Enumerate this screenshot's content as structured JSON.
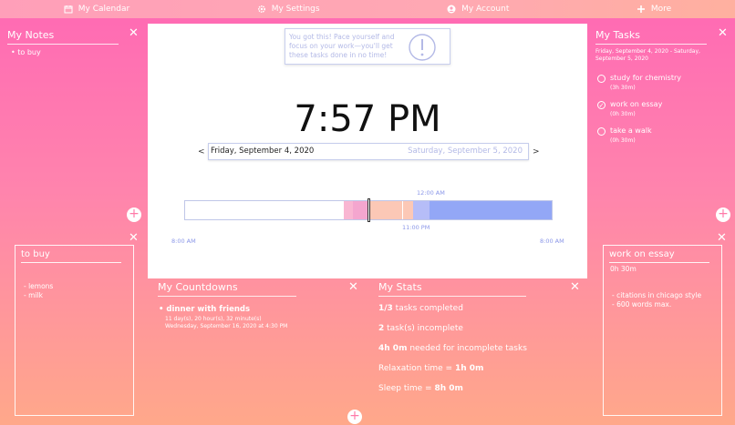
{
  "nav": {
    "calendar": "My Calendar",
    "settings": "My Settings",
    "account": "My Account",
    "more": "More"
  },
  "notes": {
    "title": "My Notes",
    "items": [
      "to buy"
    ]
  },
  "tasks": {
    "title": "My Tasks",
    "range": "Friday, September 4, 2020 - Saturday, September 5, 2020",
    "items": [
      {
        "name": "study for chemistry",
        "duration": "(3h 30m)",
        "done": false
      },
      {
        "name": "work on essay",
        "duration": "(0h 30m)",
        "done": true
      },
      {
        "name": "take a walk",
        "duration": "(0h 30m)",
        "done": false
      }
    ]
  },
  "motivation": "You got this! Pace yourself and focus on your work—you'll get these tasks done in no time!",
  "clock": "7:57 PM",
  "date_nav": {
    "prev": "<",
    "next": ">",
    "current": "Friday, September 4, 2020",
    "next_day": "Saturday, September 5, 2020"
  },
  "timeline": {
    "label_midnight": "12:00 AM",
    "label_11pm": "11:00 PM",
    "label_start": "8:00 AM",
    "label_end": "8:00 AM"
  },
  "card_left": {
    "title": "to buy",
    "items": [
      "- lemons",
      "- milk"
    ]
  },
  "card_right": {
    "title": "work on essay",
    "duration": "0h  30m",
    "items": [
      "- citations in chicago style",
      "- 600 words max."
    ]
  },
  "countdowns": {
    "title": "My Countdowns",
    "name": "dinner with friends",
    "remaining": "11 day(s), 20 hour(s), 32 minute(s)",
    "date": "Wednesday, September 16, 2020 at 4:30 PM"
  },
  "stats": {
    "title": "My Stats",
    "completed_num": "1/3",
    "completed_text": " tasks completed",
    "incomplete_num": "2",
    "incomplete_text": " task(s) incomplete",
    "needed_num": "4h 0m",
    "needed_text": " needed for incomplete tasks",
    "relax_text": "Relaxation time = ",
    "relax_num": "1h 0m",
    "sleep_text": "Sleep time = ",
    "sleep_num": "8h 0m"
  },
  "colors": {
    "accent": "#ff69b4",
    "timeline_pink": "#f9b6d2",
    "timeline_peach": "#fcc8b6",
    "timeline_lavender": "#b6bdf8",
    "timeline_blue": "#93a7f6"
  }
}
